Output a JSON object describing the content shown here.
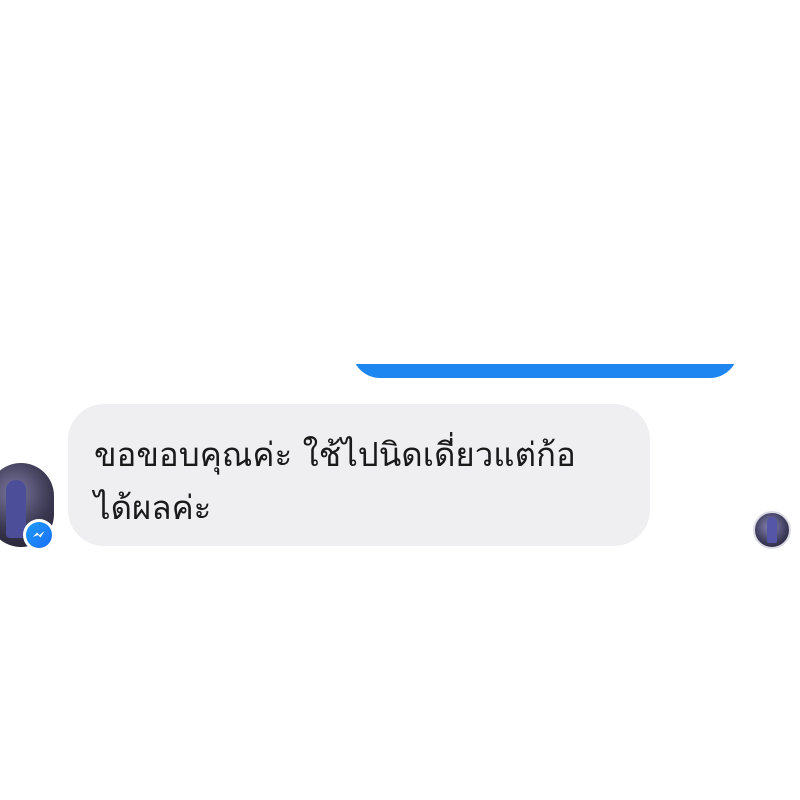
{
  "conversation": {
    "received_message": {
      "text": "ขอขอบคุณค่ะ ใช้ไปนิดเดี่ยวแต่ก้อ\nได้ผลค่ะ"
    },
    "icons": {
      "sender_avatar": "avatar",
      "platform_badge": "messenger-icon",
      "seen_indicator": "seen-avatar"
    }
  },
  "colors": {
    "sent_bubble": "#1d86f0",
    "received_bubble": "#efeff1",
    "messenger_badge": "#1a6ef5"
  }
}
